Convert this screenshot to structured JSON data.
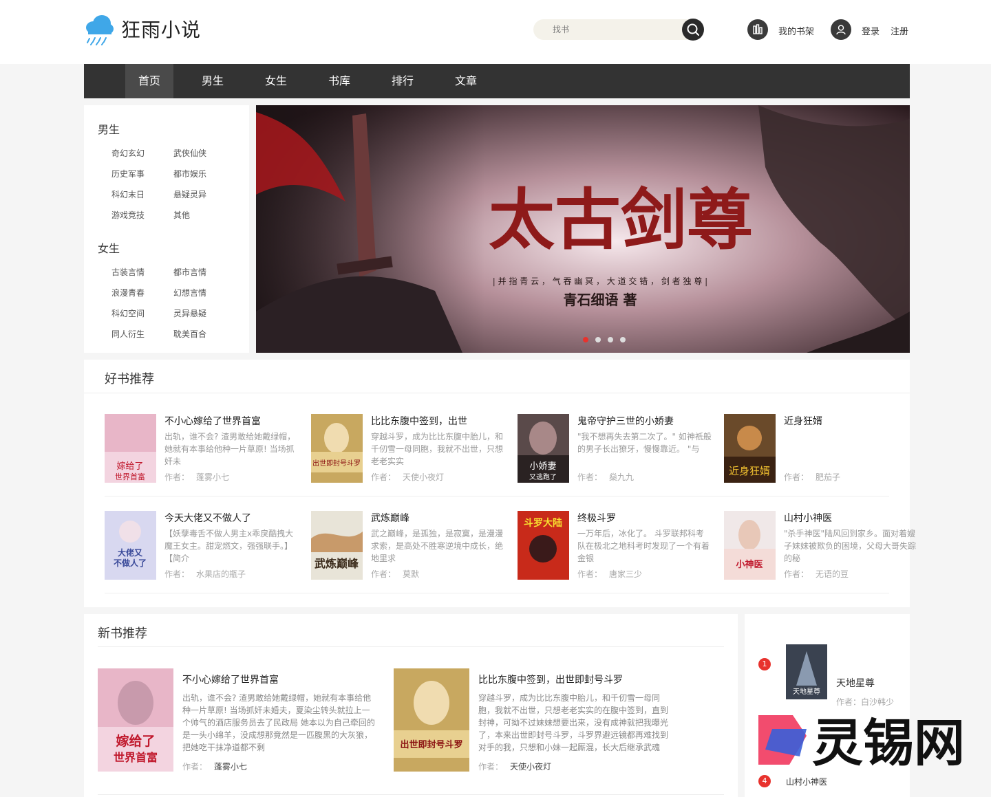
{
  "site": {
    "name": "狂雨小说"
  },
  "search": {
    "placeholder": "找书"
  },
  "header": {
    "shelf": "我的书架",
    "login": "登录",
    "register": "注册"
  },
  "nav": [
    "首页",
    "男生",
    "女生",
    "书库",
    "排行",
    "文章"
  ],
  "categories": {
    "male": {
      "title": "男生",
      "items": [
        "奇幻玄幻",
        "武侠仙侠",
        "历史军事",
        "都市娱乐",
        "科幻末日",
        "悬疑灵异",
        "游戏竞技",
        "其他"
      ]
    },
    "female": {
      "title": "女生",
      "items": [
        "古装言情",
        "都市言情",
        "浪漫青春",
        "幻想言情",
        "科幻空间",
        "灵异悬疑",
        "同人衍生",
        "耽美百合"
      ]
    }
  },
  "banner": {
    "title": "太古剑尊",
    "subtitle": "| 并 指 青 云 ， 气 吞 幽 冥 ， 大 道 交 错 ， 剑 者 独 尊 |",
    "author": "青石细语 著"
  },
  "good": {
    "title": "好书推荐",
    "author_label": "作者：",
    "books": [
      {
        "title": "不小心嫁给了世界首富",
        "desc": "出轨，谁不会? 渣男敢给她戴绿帽，她就有本事给他种一片草原! 当场抓奸未",
        "author": "蓬雾小七",
        "cover_text": "嫁给了世界首富"
      },
      {
        "title": "比比东腹中签到，出世",
        "desc": "穿越斗罗，成为比比东腹中胎儿，和千仞雪一母同胞，我就不出世，只想老老实实",
        "author": "天使小夜灯",
        "cover_text": "出世即封号斗罗"
      },
      {
        "title": "鬼帝守护三世的小娇妻",
        "desc": "\"我不想再失去第二次了。\" 如神祇般的男子长出獠牙，慢慢靠近。 \"与",
        "author": "燊九九",
        "cover_text": "小娇妻又逃跑了"
      },
      {
        "title": "近身狂婿",
        "desc": "",
        "author": "肥茄子",
        "cover_text": "近身狂婿"
      },
      {
        "title": "今天大佬又不做人了",
        "desc": "【妖孽毒舌不做人男主x乖戾酷拽大魔王女主。甜宠燃文，强强联手。】 【简介",
        "author": "水果店的瓶子",
        "cover_text": "大佬又不做人了"
      },
      {
        "title": "武炼巅峰",
        "desc": "武之巅峰，是孤独，是寂寞，是漫漫求索，是高处不胜寒逆境中成长，绝地里求",
        "author": "莫默",
        "cover_text": "武炼巅峰"
      },
      {
        "title": "终极斗罗",
        "desc": "一万年后，冰化了。 斗罗联邦科考队在极北之地科考时发现了一个有着金银",
        "author": "唐家三少",
        "cover_text": "斗罗大陆"
      },
      {
        "title": "山村小神医",
        "desc": "\"杀手神医\"陆风回到家乡。面对着嫂子妹妹被欺负的困境，父母大哥失踪的秘",
        "author": "无语的豆",
        "cover_text": "山村小神医"
      }
    ]
  },
  "newbooks": {
    "title": "新书推荐",
    "author_label": "作者：",
    "books": [
      {
        "title": "不小心嫁给了世界首富",
        "desc": "出轨，谁不会? 渣男敢给她戴绿帽，她就有本事给他种一片草原! 当场抓奸未婚夫，夏染尘转头就拉上一个帅气的酒店服务员去了民政局 她本以为自己牵回的是一头小绵羊，没成想那竟然是一匹腹黑的大灰狼，把她吃干抹净道都不剩",
        "author": "蓬雾小七",
        "cover_text": "嫁给了世界首富"
      },
      {
        "title": "比比东腹中签到，出世即封号斗罗",
        "desc": "穿越斗罗，成为比比东腹中胎儿，和千仞雪一母同胞，我就不出世，只想老老实实的在腹中签到，直到封神，可拗不过妹妹想要出来，没有成神就把我曝光了，本来出世即封号斗罗，斗罗界避远镜都再难找到对手的我，只想和小妹一起厮混，长大后继承武魂殿，",
        "author": "天使小夜灯",
        "cover_text": "出世即封号斗罗"
      }
    ]
  },
  "rank": {
    "items": [
      {
        "num": "1",
        "name": "天地星尊",
        "author": "作者：白沙韩少"
      },
      {
        "num": "4",
        "name": "山村小神医"
      }
    ]
  },
  "watermark": {
    "text": "灵锡网"
  }
}
